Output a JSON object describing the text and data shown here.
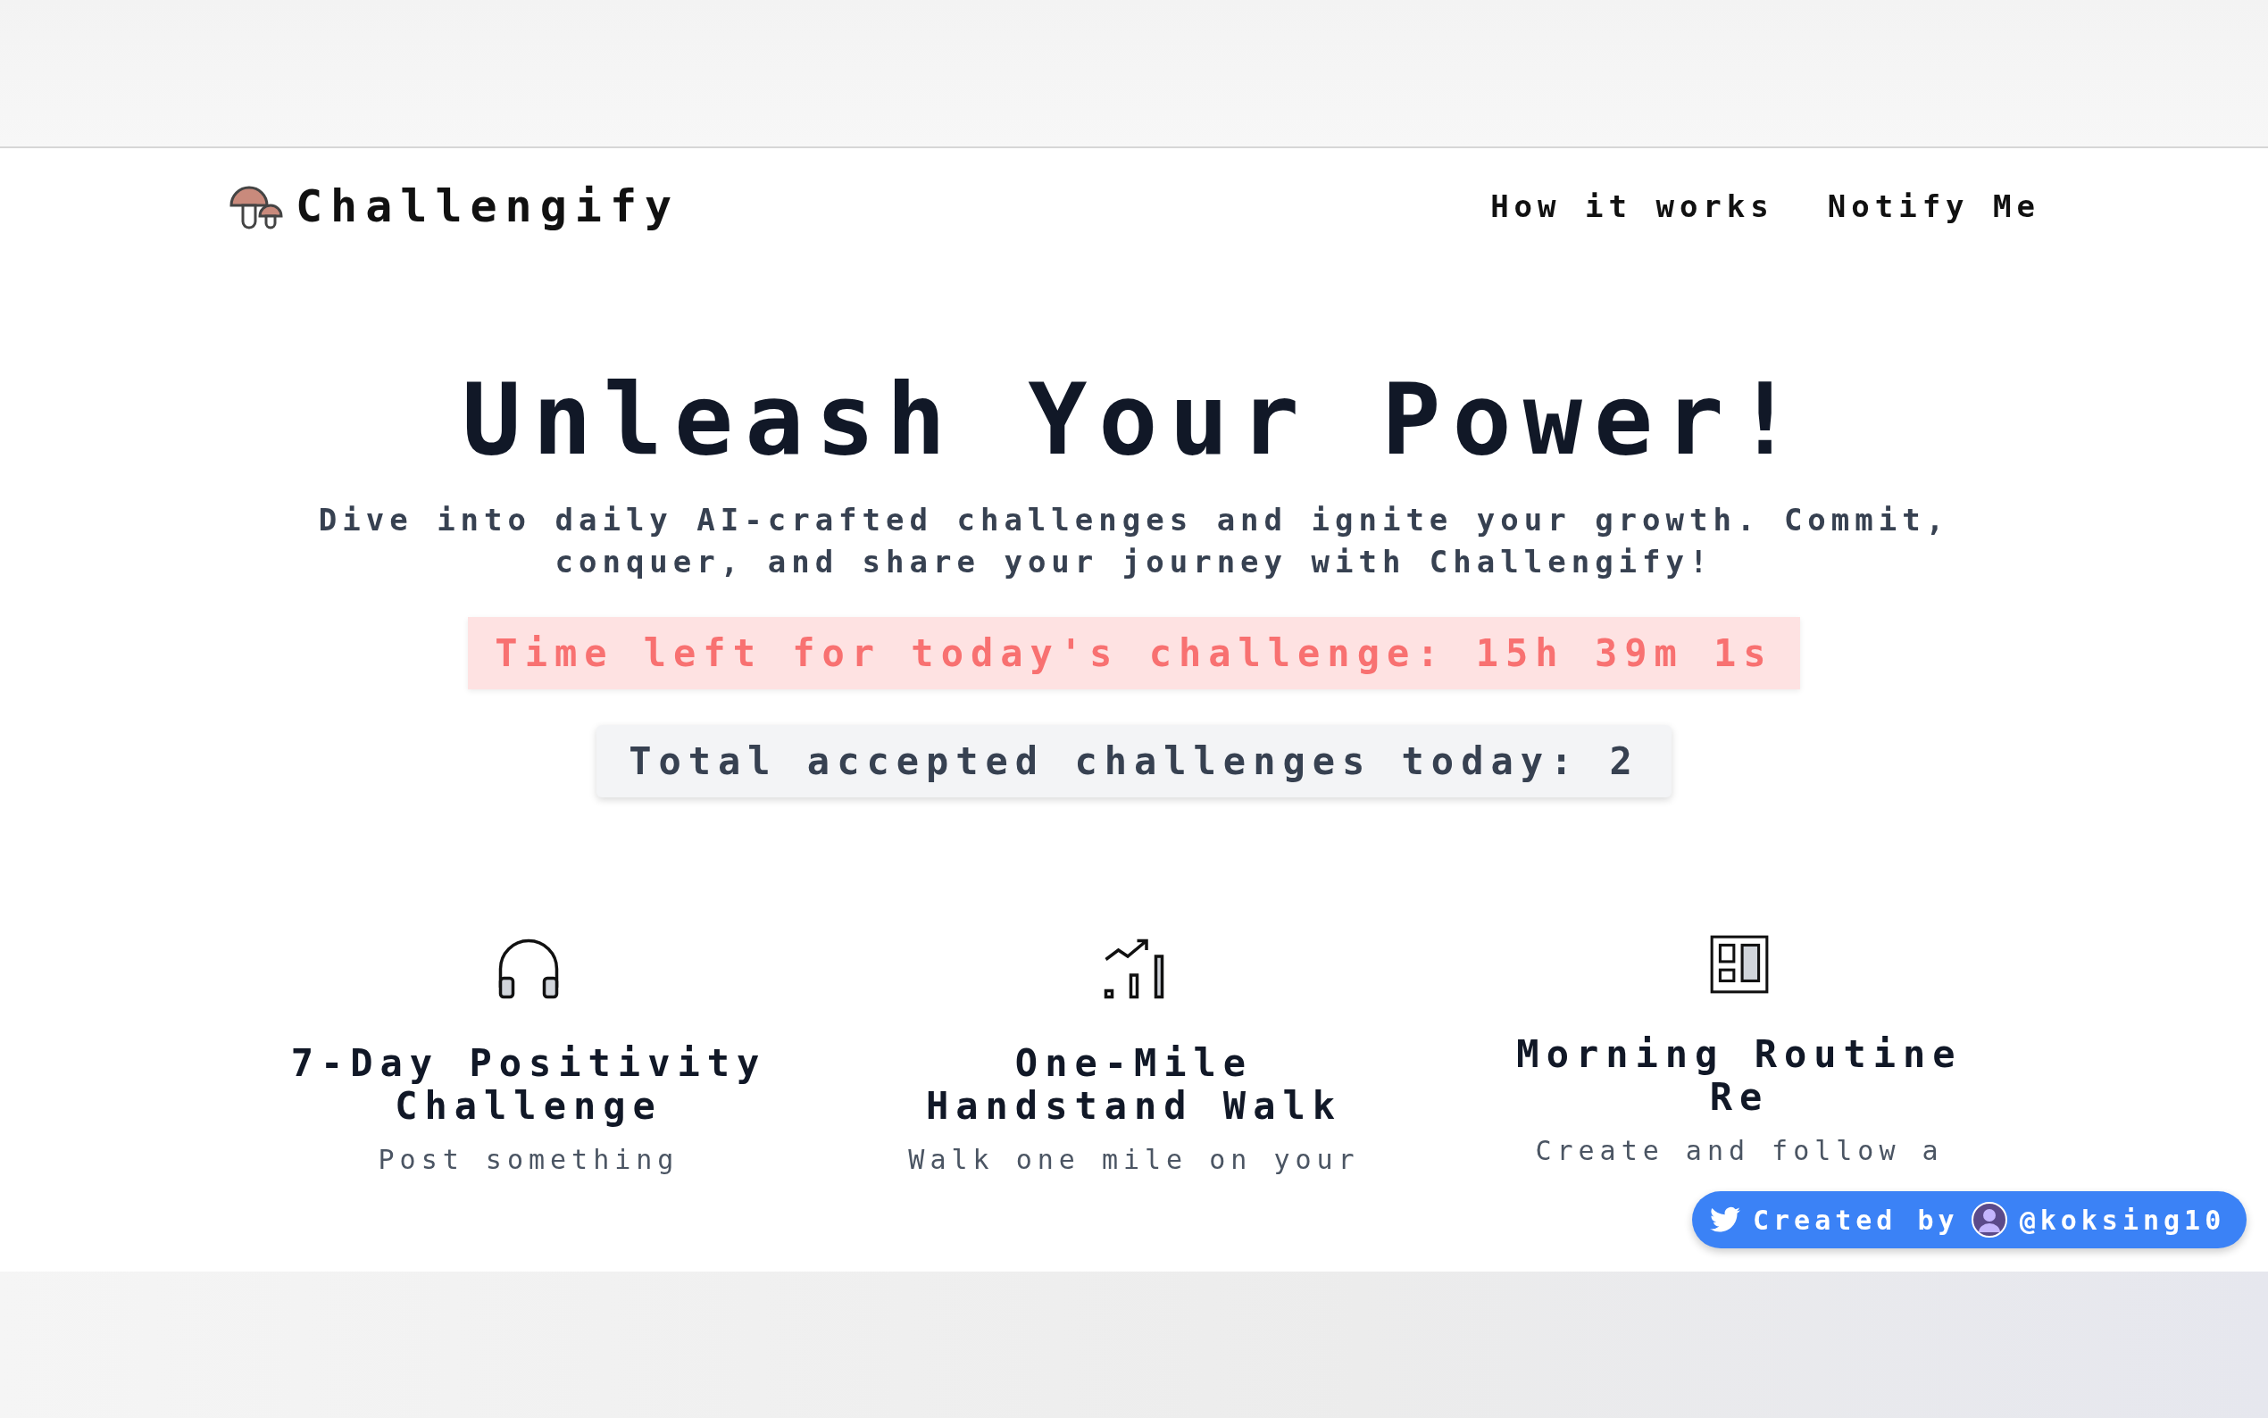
{
  "brand": {
    "name": "Challengify"
  },
  "nav": [
    "How it works",
    "Notify Me"
  ],
  "hero": {
    "title": "Unleash Your Power!",
    "subtitle": "Dive into daily AI-crafted challenges and ignite your growth. Commit, conquer, and share your journey with Challengify!"
  },
  "timer": "Time left for today's challenge: 15h 39m 1s",
  "total": "Total accepted challenges today: 2",
  "challenges": [
    {
      "kind": "headphones",
      "title": "7-Day Positivity Challenge",
      "description": "Post something"
    },
    {
      "kind": "chart",
      "title": "One-Mile Handstand Walk",
      "description": "Walk one mile on your"
    },
    {
      "kind": "layout",
      "title": "Morning Routine Re",
      "description": "Create and follow a"
    }
  ],
  "credit": {
    "label": "Created by",
    "handle": "@koksing10"
  }
}
